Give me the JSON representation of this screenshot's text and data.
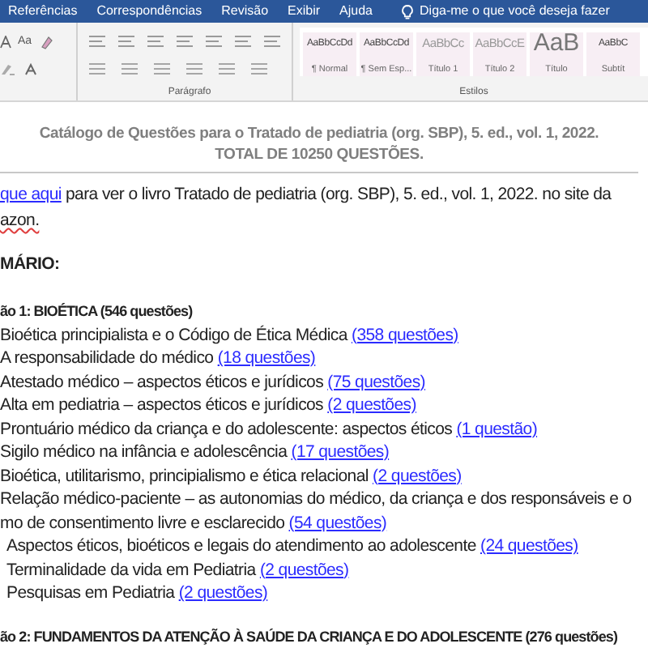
{
  "ribbon": {
    "tabs": [
      "Referências",
      "Correspondências",
      "Revisão",
      "Exibir",
      "Ajuda"
    ],
    "tell_me": "Diga-me o que você deseja fazer",
    "font_group": {
      "case_label": "Aa"
    },
    "groups": [
      "Parágrafo",
      "Estilos"
    ],
    "styles": [
      {
        "sample": "AaBbCcDd",
        "name": "¶ Normal",
        "kind": "small"
      },
      {
        "sample": "AaBbCcDd",
        "name": "¶ Sem Esp...",
        "kind": "small"
      },
      {
        "sample": "AaBbCc",
        "name": "Título 1",
        "kind": "medium"
      },
      {
        "sample": "AaBbCcE",
        "name": "Título 2",
        "kind": "medium"
      },
      {
        "sample": "AaB",
        "name": "Título",
        "kind": "large"
      },
      {
        "sample": "AaBbC",
        "name": "Subtít",
        "kind": "small"
      }
    ]
  },
  "document": {
    "title_lines": [
      "Catálogo de Questões para o Tratado de pediatria (org. SBP), 5. ed., vol. 1, 2022.",
      "TOTAL DE 10250 QUESTÕES."
    ],
    "intro": {
      "link": "que aqui",
      "text": " para ver o livro Tratado de pediatria (org. SBP), 5. ed., vol. 1, 2022. no site da",
      "continuation": "azon."
    },
    "heading": "MÁRIO:",
    "sections": [
      {
        "title": "ão 1: BIOÉTICA (546 questões)",
        "items": [
          {
            "lines": [
              "Bioética principialista e o Código de Ética Médica"
            ],
            "link": "(358 questões)",
            "indented": false
          },
          {
            "lines": [
              "A responsabilidade do médico"
            ],
            "link": "(18 questões)",
            "indented": false
          },
          {
            "lines": [
              "Atestado médico – aspectos éticos e jurídicos"
            ],
            "link": "(75 questões)",
            "indented": false
          },
          {
            "lines": [
              "Alta em pediatria – aspectos éticos e jurídicos"
            ],
            "link": "(2 questões)",
            "indented": false
          },
          {
            "lines": [
              "Prontuário médico da criança e do adolescente: aspectos éticos"
            ],
            "link": "(1 questão)",
            "indented": false
          },
          {
            "lines": [
              "Sigilo médico na infância e adolescência"
            ],
            "link": "(17 questões)",
            "indented": false
          },
          {
            "lines": [
              "Bioética, utilitarismo, principialismo e ética relacional"
            ],
            "link": "(2 questões)",
            "indented": false
          },
          {
            "lines": [
              "Relação médico-paciente – as autonomias do médico, da criança e dos responsáveis e o",
              "mo de consentimento livre e esclarecido"
            ],
            "link": "(54 questões)",
            "indented": false
          },
          {
            "lines": [
              "Aspectos éticos, bioéticos e legais do atendimento ao adolescente"
            ],
            "link": "(24 questões)",
            "indented": true
          },
          {
            "lines": [
              "Terminalidade da vida em Pediatria"
            ],
            "link": "(2 questões)",
            "indented": true
          },
          {
            "lines": [
              "Pesquisas em Pediatria"
            ],
            "link": "(2 questões)",
            "indented": true
          }
        ]
      },
      {
        "title": "ão 2: FUNDAMENTOS DA ATENÇÃO À SAÚDE DA CRIANÇA E DO ADOLESCENTE (276 questões)"
      }
    ]
  }
}
